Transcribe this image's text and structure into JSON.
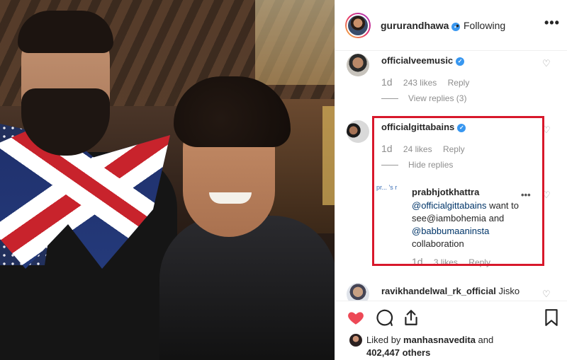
{
  "post": {
    "author": "gururandhawa",
    "separator": "•",
    "follow_status": "Following",
    "more_label": "•••"
  },
  "comments": [
    {
      "user": "officialveemusic",
      "text": "",
      "time": "1d",
      "likes": "243 likes",
      "reply": "Reply",
      "replies_toggle": "View replies (3)"
    },
    {
      "user": "officialgittabains",
      "text": "",
      "time": "1d",
      "likes": "24 likes",
      "reply": "Reply",
      "replies_toggle": "Hide replies",
      "replies": [
        {
          "user": "prabhjotkhattra",
          "avatar_alt": "pr... 's r",
          "mention1": "@officialgittabains",
          "text1": " want to see@iambohemia and",
          "mention2": "@babbumaaninsta",
          "text2": "collaboration",
          "time": "1d",
          "likes": "3 likes",
          "reply": "Reply",
          "more_label": "•••"
        }
      ]
    },
    {
      "user": "ravikhandelwal_rk_official",
      "text": "Jisko"
    }
  ],
  "likes_line": {
    "prefix": "Liked by",
    "user": "manhasnavedita",
    "conj": "and",
    "count": "402,447 others"
  },
  "icons": {
    "like": "heart-icon",
    "comment": "comment-icon",
    "share": "share-icon",
    "save": "bookmark-icon"
  },
  "colors": {
    "like_red": "#ed4956",
    "verified_blue": "#3897f0",
    "highlight_red": "#d8182b"
  }
}
